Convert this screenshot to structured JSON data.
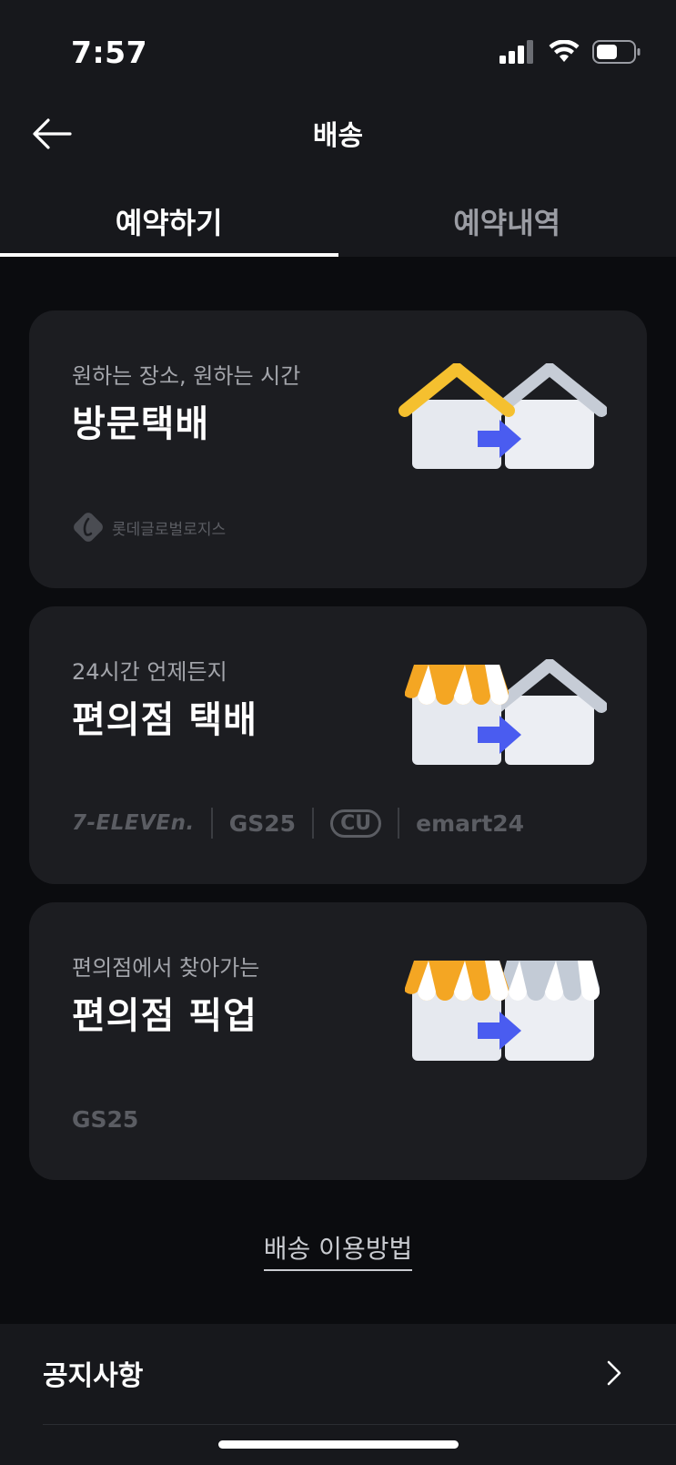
{
  "status": {
    "time": "7:57"
  },
  "nav": {
    "title": "배송"
  },
  "tabs": [
    {
      "label": "예약하기",
      "active": true
    },
    {
      "label": "예약내역",
      "active": false
    }
  ],
  "cards": [
    {
      "subtitle": "원하는 장소, 원하는 시간",
      "title": "방문택배",
      "brands": [
        "롯데글로벌로지스"
      ]
    },
    {
      "subtitle": "24시간 언제든지",
      "title": "편의점 택배",
      "brands": [
        "7-ELEVEn.",
        "GS25",
        "CU",
        "emart24"
      ]
    },
    {
      "subtitle": "편의점에서 찾아가는",
      "title": "편의점 픽업",
      "brands": [
        "GS25"
      ]
    }
  ],
  "usage_link": "배송 이용방법",
  "notice": {
    "label": "공지사항"
  },
  "icons": {
    "back": "arrow-left-icon",
    "chevron": "chevron-right-icon",
    "signal": "cellular-signal-icon",
    "wifi": "wifi-icon",
    "battery": "battery-icon"
  },
  "colors": {
    "background": "#0b0c0f",
    "surface": "#17181c",
    "card": "#1c1d21",
    "accent_arrow": "#4a5cf0",
    "roof_yellow": "#f5c02f",
    "awning_orange": "#f4a623"
  }
}
